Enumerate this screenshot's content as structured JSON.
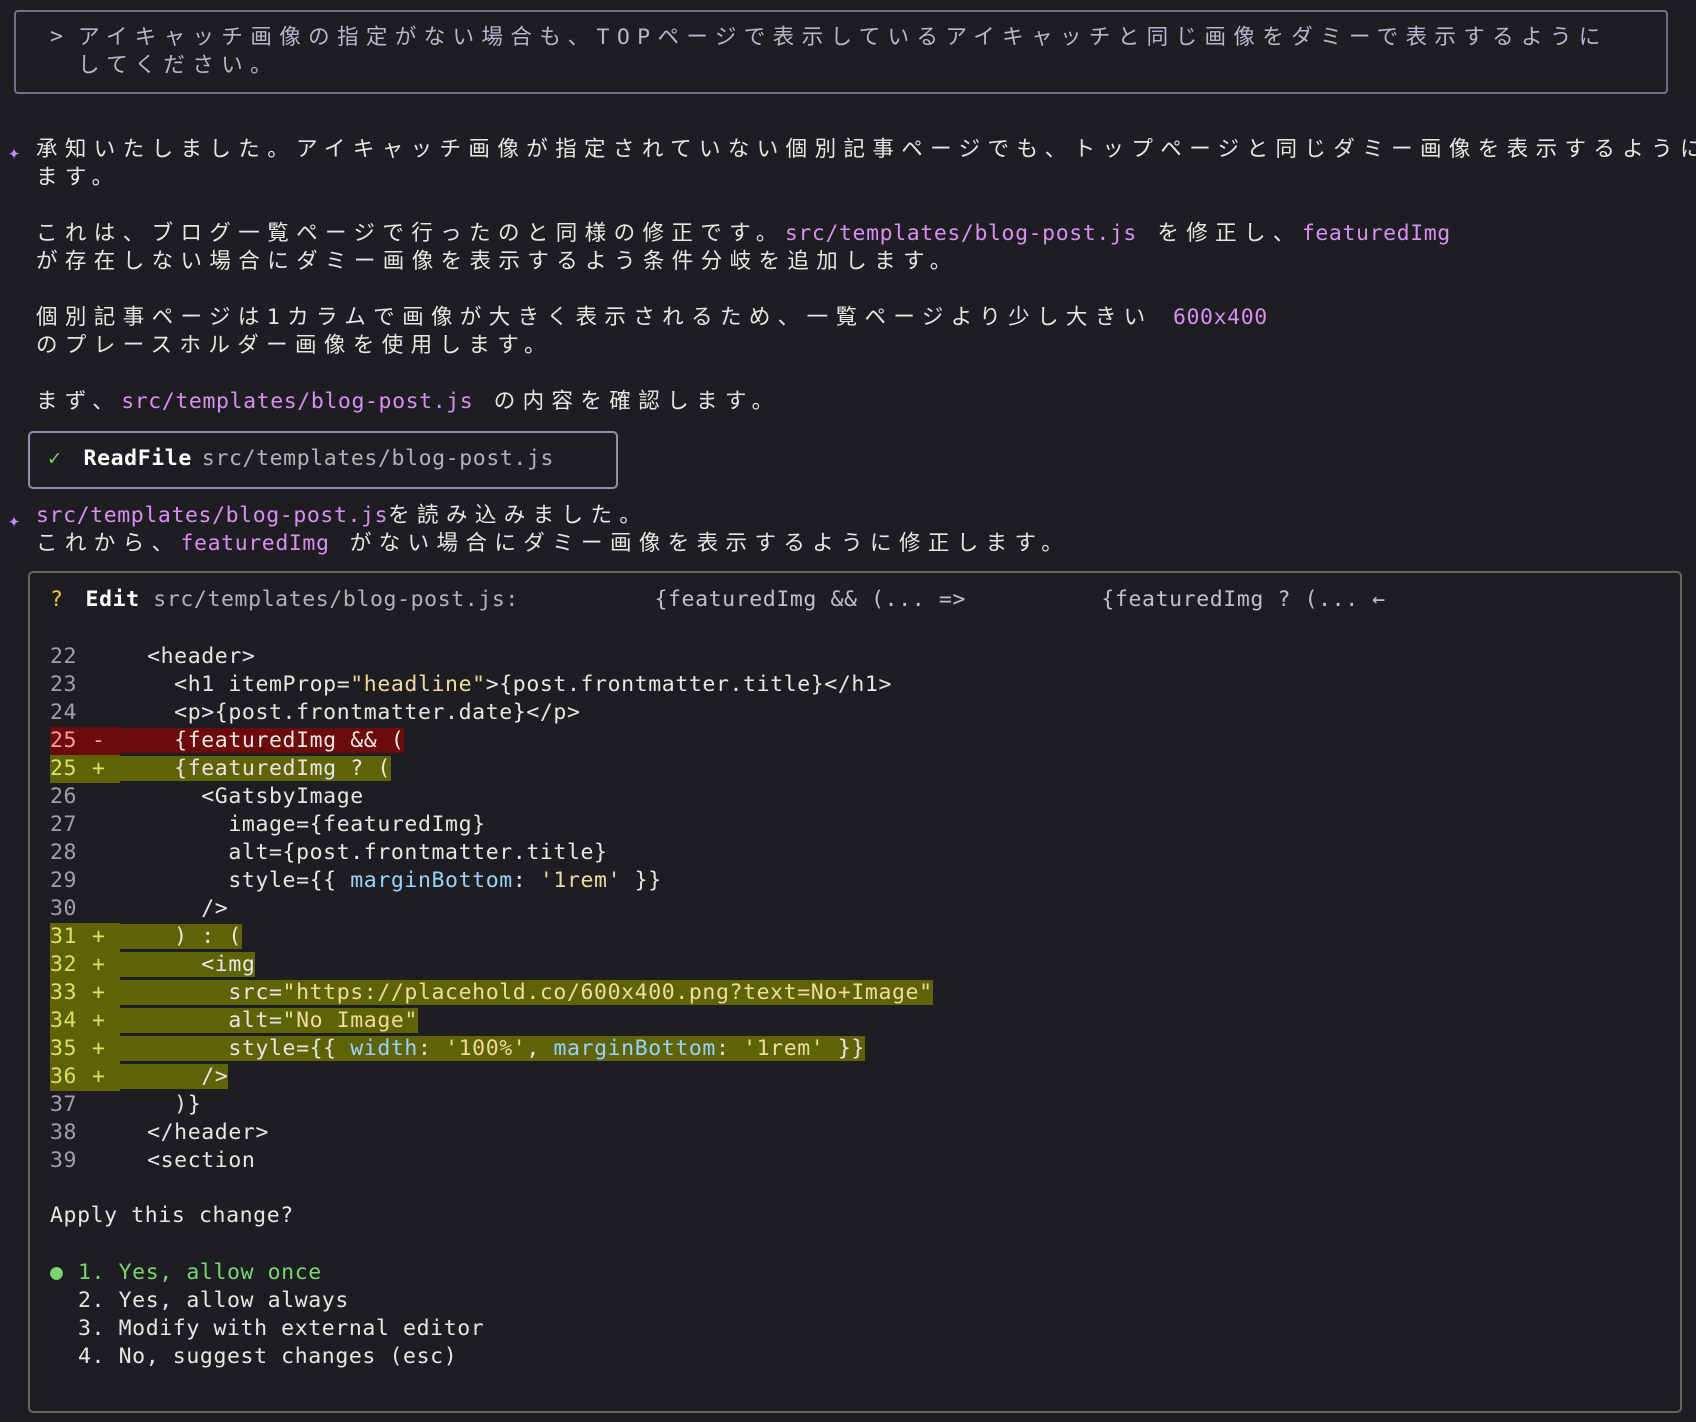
{
  "prompt": {
    "caret": ">",
    "text": "アイキャッチ画像の指定がない場合も、TOPページで表示しているアイキャッチと同じ画像をダミーで表示するようにしてください。"
  },
  "response1": {
    "line1": "承知いたしました。アイキャッチ画像が指定されていない個別記事ページでも、トップページと同じダミー画像を表示するようにし",
    "line2": "ます。",
    "p2_a": "これは、ブログ一覧ページで行ったのと同様の修正です。",
    "p2_path": "src/templates/blog-post.js",
    "p2_b": " を修正し、",
    "p2_var": "featuredImg",
    "p2_line2": "が存在しない場合にダミー画像を表示するよう条件分岐を追加します。",
    "p3_a": "個別記事ページは1カラムで画像が大きく表示されるため、一覧ページより少し大きい ",
    "p3_size": "600x400",
    "p3_line2": "のプレースホルダー画像を使用します。",
    "p4_a": "まず、",
    "p4_path": "src/templates/blog-post.js",
    "p4_b": " の内容を確認します。"
  },
  "tool": {
    "check": "✓",
    "name": "ReadFile",
    "arg": "src/templates/blog-post.js"
  },
  "response2": {
    "path": "src/templates/blog-post.js",
    "line1_b": "を読み込みました。",
    "line2_a": "これから、",
    "line2_var": "featuredImg",
    "line2_b": " がない場合にダミー画像を表示するように修正します。"
  },
  "edit": {
    "marker": "?",
    "title": "Edit",
    "file": "src/templates/blog-post.js:",
    "from": "{featuredImg && (... =>",
    "to": "{featuredImg ? (... ←",
    "lines": [
      {
        "n": "22",
        "m": " ",
        "t": "  <header>",
        "type": "ctx"
      },
      {
        "n": "23",
        "m": " ",
        "t": "    <h1 itemProp=",
        "s": "\"headline\"",
        "t2": ">{post.frontmatter.title}</h1>",
        "type": "ctx"
      },
      {
        "n": "24",
        "m": " ",
        "t": "    <p>{post.frontmatter.date}</p>",
        "type": "ctx"
      },
      {
        "n": "25",
        "m": "-",
        "t": "    {featuredImg && (",
        "type": "removed"
      },
      {
        "n": "25",
        "m": "+",
        "t": "    {featuredImg ? (",
        "type": "added"
      },
      {
        "n": "26",
        "m": " ",
        "t": "      <GatsbyImage",
        "type": "ctx"
      },
      {
        "n": "27",
        "m": " ",
        "t": "        image={featuredImg}",
        "type": "ctx"
      },
      {
        "n": "28",
        "m": " ",
        "t": "        alt={post.frontmatter.title}",
        "type": "ctx"
      },
      {
        "n": "29",
        "m": " ",
        "t": "        style={{ ",
        "p": "marginBottom",
        "t2": ": ",
        "s": "'1rem'",
        "t3": " }}",
        "type": "ctx"
      },
      {
        "n": "30",
        "m": " ",
        "t": "      />",
        "type": "ctx"
      },
      {
        "n": "31",
        "m": "+",
        "t": "    ) : (",
        "type": "added"
      },
      {
        "n": "32",
        "m": "+",
        "t": "      <img",
        "type": "added"
      },
      {
        "n": "33",
        "m": "+",
        "t": "        src=",
        "s": "\"https://placehold.co/600x400.png?text=No+Image\"",
        "type": "added"
      },
      {
        "n": "34",
        "m": "+",
        "t": "        alt=",
        "s": "\"No Image\"",
        "type": "added"
      },
      {
        "n": "35",
        "m": "+",
        "t": "        style={{ ",
        "p": "width",
        "t2": ": ",
        "s": "'100%'",
        "t3": ", ",
        "p2": "marginBottom",
        "t4": ": ",
        "s2": "'1rem'",
        "t5": " }}",
        "type": "added"
      },
      {
        "n": "36",
        "m": "+",
        "t": "      />",
        "type": "added"
      },
      {
        "n": "37",
        "m": " ",
        "t": "    )}",
        "type": "ctx"
      },
      {
        "n": "38",
        "m": " ",
        "t": "  </header>",
        "type": "ctx"
      },
      {
        "n": "39",
        "m": " ",
        "t": "  <section",
        "type": "ctx"
      }
    ],
    "question": "Apply this change?",
    "options": [
      {
        "label": "1. Yes, allow once",
        "selected": true
      },
      {
        "label": "2. Yes, allow always",
        "selected": false
      },
      {
        "label": "3. Modify with external editor",
        "selected": false
      },
      {
        "label": "4. No, suggest changes (esc)",
        "selected": false
      }
    ]
  }
}
